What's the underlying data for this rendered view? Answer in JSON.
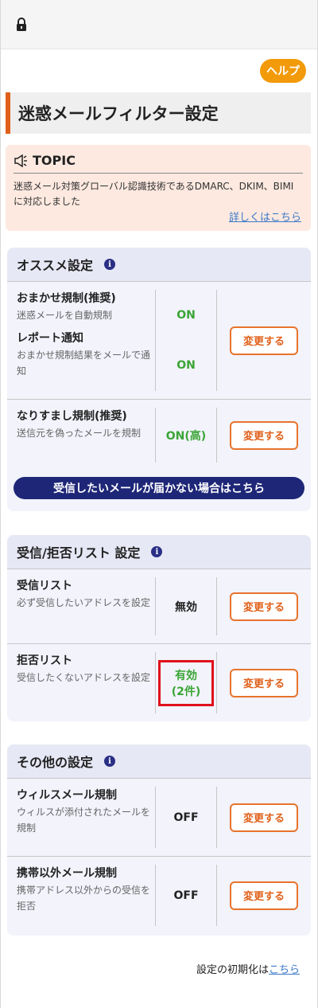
{
  "header": {
    "lock_icon": "lock-icon",
    "help_label": "ヘルプ"
  },
  "page": {
    "title": "迷惑メールフィルター設定"
  },
  "topic": {
    "heading": "TOPIC",
    "text": "迷惑メール対策グローバル認識技術であるDMARC、DKIM、BIMIに対応しました",
    "link": "詳しくはこちら"
  },
  "recommended": {
    "title": "オススメ設定",
    "omakase_name": "おまかせ規制(推奨)",
    "omakase_desc": "迷惑メールを自動規制",
    "omakase_value": "ON",
    "report_name": "レポート通知",
    "report_desc": "おまかせ規制結果をメールで通知",
    "report_value": "ON",
    "spoof_name": "なりすまし規制(推奨)",
    "spoof_desc": "送信元を偽ったメールを規制",
    "spoof_value": "ON(高)",
    "change_label": "変更する",
    "help_link": "受信したいメールが届かない場合はこちら"
  },
  "lists": {
    "title": "受信/拒否リスト 設定",
    "accept_name": "受信リスト",
    "accept_desc": "必ず受信したいアドレスを設定",
    "accept_value": "無効",
    "reject_name": "拒否リスト",
    "reject_desc": "受信したくないアドレスを設定",
    "reject_value_line1": "有効",
    "reject_value_line2": "(2件)",
    "change_label": "変更する"
  },
  "other": {
    "title": "その他の設定",
    "virus_name": "ウィルスメール規制",
    "virus_desc": "ウィルスが添付されたメールを規制",
    "virus_value": "OFF",
    "nonmobile_name": "携帯以外メール規制",
    "nonmobile_desc": "携帯アドレス以外からの受信を拒否",
    "nonmobile_value": "OFF",
    "change_label": "変更する"
  },
  "footer": {
    "text": "設定の初期化は",
    "link": "こちら"
  },
  "colors": {
    "accent": "#e0601a",
    "navy": "#1e2677",
    "green": "#3aa535",
    "help": "#f29a0a",
    "highlight_border": "#e0101a"
  }
}
